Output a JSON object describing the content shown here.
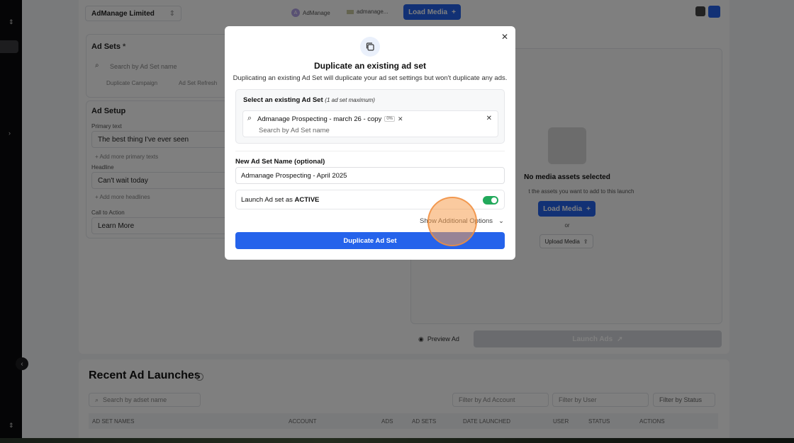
{
  "header": {
    "account_select": "AdManage Limited",
    "page_avatar_letter": "A",
    "page_name": "AdManage",
    "instagram_name": "admanage...",
    "load_media_top": "Load Media"
  },
  "adsets": {
    "title": "Ad Sets",
    "required_mark": "*",
    "search_placeholder": "Search by Ad Set name",
    "duplicate_campaign": "Duplicate Campaign",
    "refresh": "Ad Set Refresh"
  },
  "setup": {
    "title": "Ad Setup",
    "primary_label": "Primary text",
    "primary_value": "The best thing I've ever seen",
    "add_primary": "+ Add more primary texts",
    "headline_label": "Headline",
    "headline_value": "Can't wait today",
    "add_headline": "+ Add more headlines",
    "cta_label": "Call to Action",
    "cta_value": "Learn More"
  },
  "media": {
    "empty_title": "No media assets selected",
    "empty_desc": "t the assets you want to add to this launch",
    "load_media": "Load Media",
    "or": "or",
    "upload_media": "Upload Media",
    "preview_ad": "Preview Ad",
    "launch_ads": "Launch Ads"
  },
  "recent": {
    "title": "Recent Ad Launches",
    "search_placeholder": "Search by adset name",
    "filter_account": "Filter by Ad Account",
    "filter_user": "Filter by User",
    "filter_status": "Filter by Status",
    "columns": [
      "AD SET NAMES",
      "ACCOUNT",
      "ADS",
      "AD SETS",
      "DATE LAUNCHED",
      "USER",
      "STATUS",
      "ACTIONS"
    ]
  },
  "modal": {
    "title": "Duplicate an existing ad set",
    "description": "Duplicating an existing Ad Set will duplicate your ad set settings but won't duplicate any ads.",
    "select_label": "Select an existing Ad Set",
    "select_hint": "(1 ad set maximum)",
    "selected_tag": "Admanage Prospecting - march 26 - copy",
    "selected_count": "0%",
    "search_placeholder": "Search by Ad Set name",
    "name_label": "New Ad Set Name (optional)",
    "name_value": "Admanage Prospecting - April 2025",
    "launch_prefix": "Launch Ad set as",
    "launch_status": "ACTIVE",
    "more_options": "Show Additional Options",
    "submit": "Duplicate Ad Set"
  },
  "colors": {
    "accent": "#2563eb",
    "toggle_on": "#22a95b",
    "cursor": "#f59e50"
  }
}
